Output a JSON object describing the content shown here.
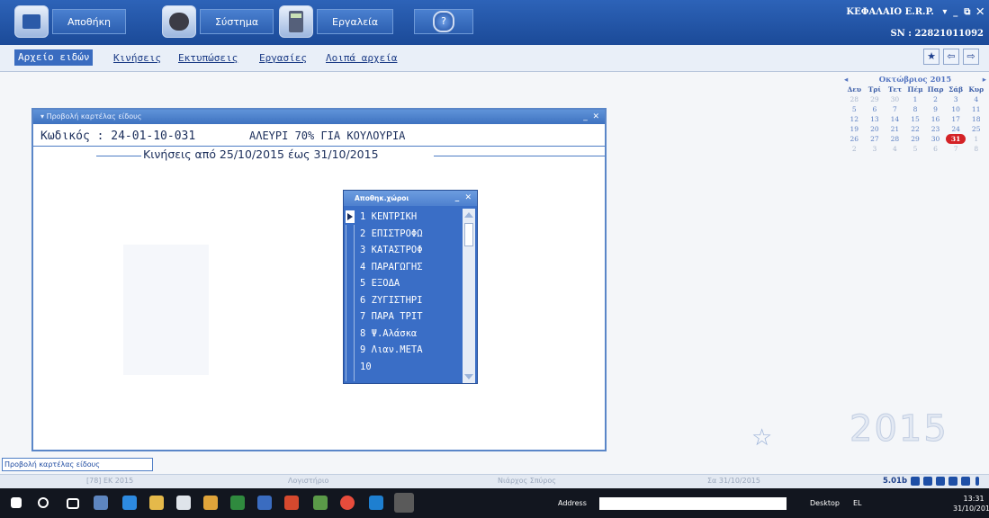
{
  "topbar": {
    "buttons": [
      {
        "label": "Αποθήκη",
        "icon": "warehouse-icon"
      },
      {
        "label": "Σύστημα",
        "icon": "system-icon"
      },
      {
        "label": "Εργαλεία",
        "icon": "calculator-icon"
      },
      {
        "label": "",
        "icon": "help-icon"
      }
    ],
    "brand": "ΚΕΦΑΛΑΙΟ E.R.P.",
    "serial": "SN : 22821011092"
  },
  "menu": [
    "Αρχείο ειδών",
    "Κινήσεις",
    "Εκτυπώσεις",
    "Εργασίες",
    "Λοιπά αρχεία"
  ],
  "calendar": {
    "month": "Οκτώβριος 2015",
    "daynames": [
      "Δευ",
      "Τρί",
      "Τετ",
      "Πέμ",
      "Παρ",
      "Σάβ",
      "Κυρ"
    ],
    "weeks": [
      [
        "28",
        "29",
        "30",
        "1",
        "2",
        "3",
        "4"
      ],
      [
        "5",
        "6",
        "7",
        "8",
        "9",
        "10",
        "11"
      ],
      [
        "12",
        "13",
        "14",
        "15",
        "16",
        "17",
        "18"
      ],
      [
        "19",
        "20",
        "21",
        "22",
        "23",
        "24",
        "25"
      ],
      [
        "26",
        "27",
        "28",
        "29",
        "30",
        "31",
        "1"
      ],
      [
        "2",
        "3",
        "4",
        "5",
        "6",
        "7",
        "8"
      ]
    ],
    "today": "31"
  },
  "window": {
    "title": "Προβολή καρτέλας είδους",
    "code_label": "Κωδικός : 24-01-10-031",
    "description": "ΑΛΕΥΡΙ 70% ΓΙΑ ΚΟΥΛΟΥΡΙΑ",
    "range": "Κινήσεις από 25/10/2015 έως 31/10/2015"
  },
  "popup": {
    "title": "Αποθηκ.χώροι",
    "items": [
      "1 ΚΕΝΤΡΙΚΗ",
      "2 ΕΠΙΣΤΡΟΦΩ",
      "3 ΚΑΤΑΣΤΡΟΦ",
      "4 ΠΑΡΑΓΩΓΗΣ",
      "5 ΕΞΟΔΑ",
      "6 ΖΥΓΙΣΤΗΡΙ",
      "7 ΠΑΡΑ ΤΡΙΤ",
      "8 Ψ.Αλάσκα",
      "9 Λιαν.ΜΕΤΑ",
      "10"
    ]
  },
  "year": "2015",
  "status": {
    "tab": "Προβολή καρτέλας είδους",
    "fields": [
      "[78] ΕΚ 2015",
      "Λογιστήριο",
      "Νιάρχος Σπύρος",
      "Σα 31/10/2015"
    ],
    "version": "5.01b"
  },
  "taskbar": {
    "address_label": "Address",
    "desktop": "Desktop",
    "lang": "EL",
    "time": "13:31",
    "date": "31/10/2015"
  }
}
